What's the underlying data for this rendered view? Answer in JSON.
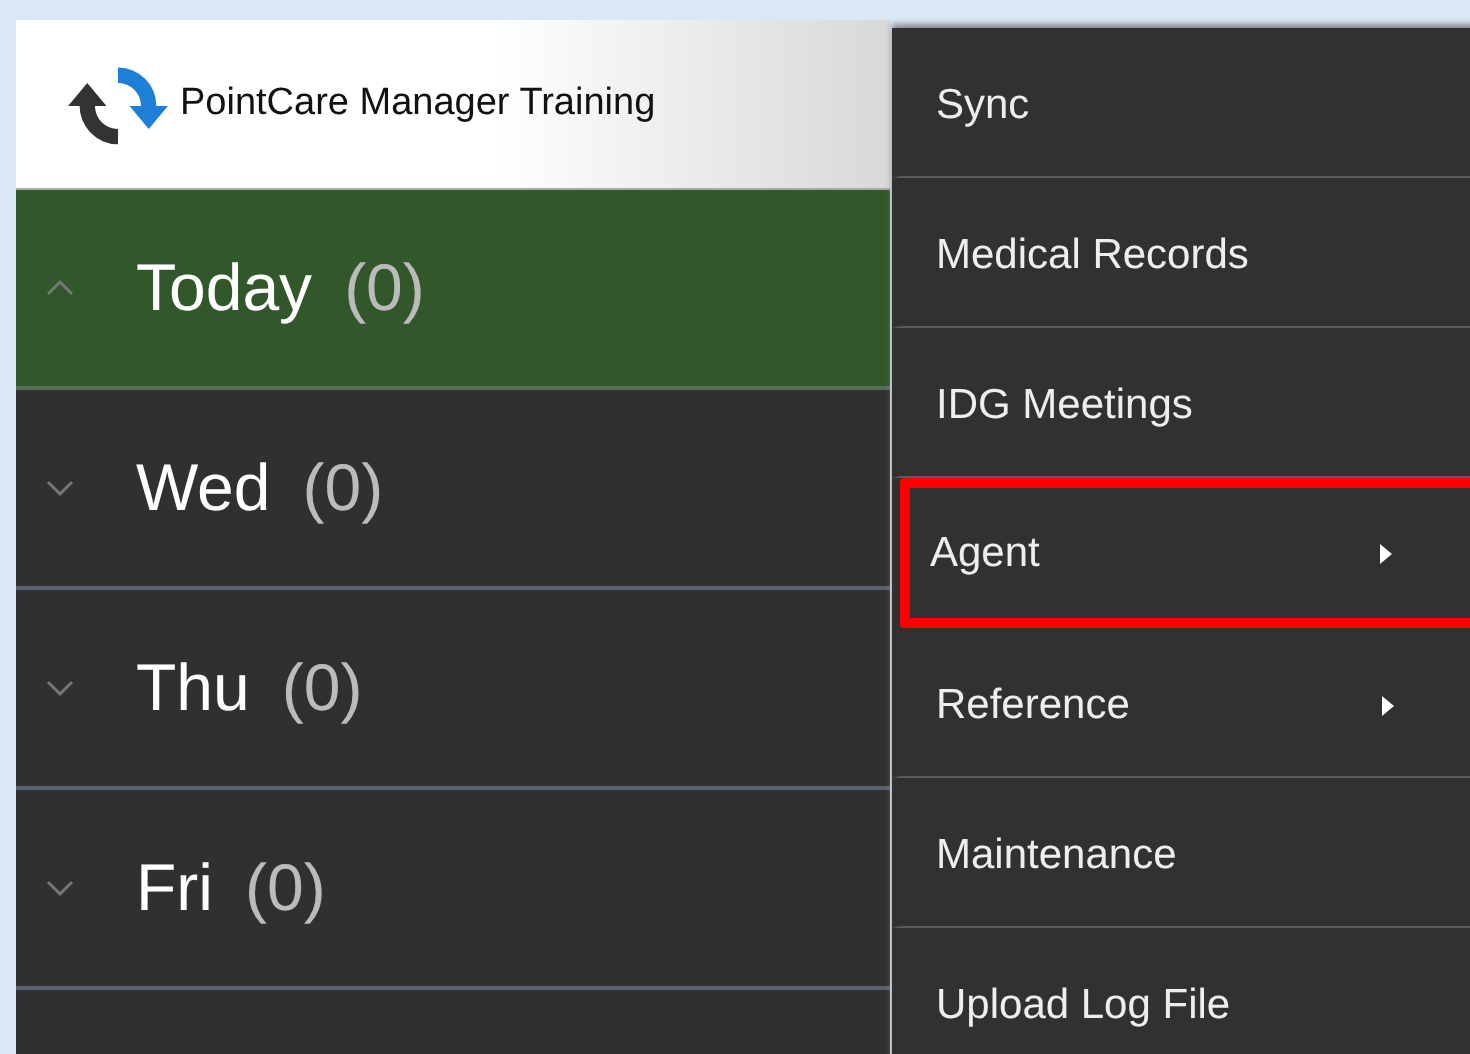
{
  "header": {
    "title": "PointCare Manager Training"
  },
  "days": [
    {
      "label": "Today",
      "count": "(0)",
      "expanded": true,
      "selected": true
    },
    {
      "label": "Wed",
      "count": "(0)",
      "expanded": false,
      "selected": false
    },
    {
      "label": "Thu",
      "count": "(0)",
      "expanded": false,
      "selected": false
    },
    {
      "label": "Fri",
      "count": "(0)",
      "expanded": false,
      "selected": false
    }
  ],
  "menu": [
    {
      "label": "Sync",
      "submenu": false,
      "highlighted": false
    },
    {
      "label": "Medical Records",
      "submenu": false,
      "highlighted": false
    },
    {
      "label": "IDG Meetings",
      "submenu": false,
      "highlighted": false
    },
    {
      "label": "Agent",
      "submenu": true,
      "highlighted": true
    },
    {
      "label": "Reference",
      "submenu": true,
      "highlighted": false
    },
    {
      "label": "Maintenance",
      "submenu": false,
      "highlighted": false
    },
    {
      "label": "Upload Log File",
      "submenu": false,
      "highlighted": false
    }
  ]
}
